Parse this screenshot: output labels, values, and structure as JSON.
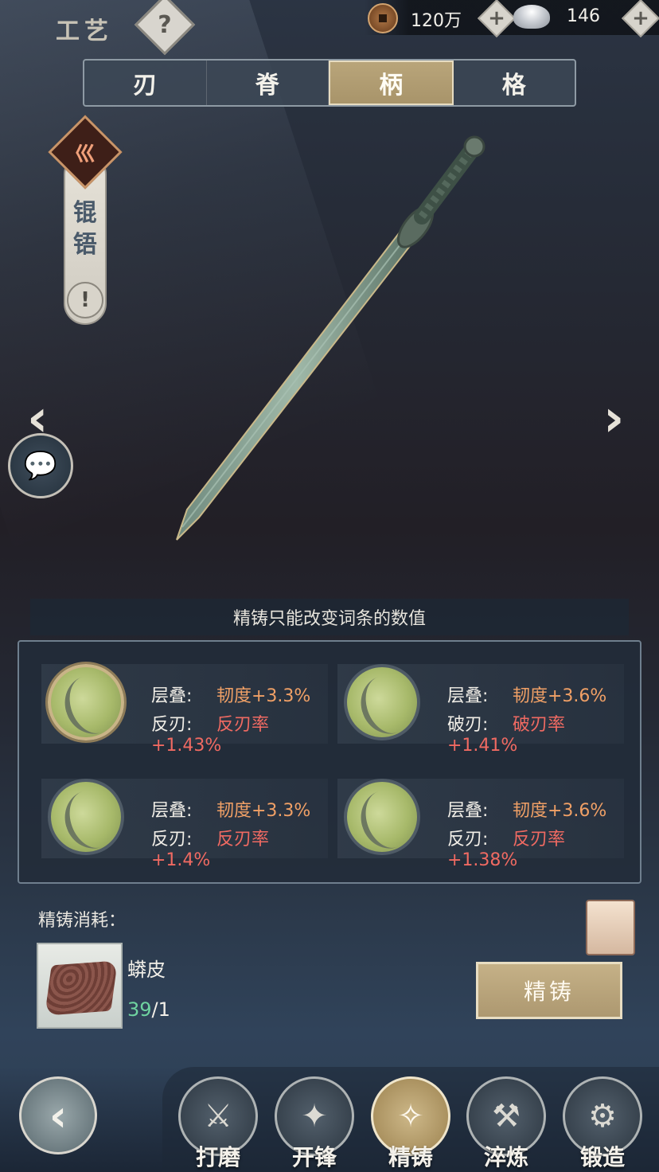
{
  "header": {
    "title": "工艺",
    "help_icon": "question-mark",
    "copper": {
      "icon": "copper-coin-icon",
      "value": "120万"
    },
    "silver": {
      "icon": "silver-ingot-icon",
      "value": "146"
    }
  },
  "tabs": [
    {
      "label": "刃",
      "active": false
    },
    {
      "label": "脊",
      "active": false
    },
    {
      "label": "柄",
      "active": true
    },
    {
      "label": "格",
      "active": false
    }
  ],
  "weapon": {
    "name_line1": "锟",
    "name_line2": "铻",
    "emblem_glyph": "巛",
    "alert_glyph": "!"
  },
  "nav_arrows": {
    "left": "‹",
    "right": "›"
  },
  "info_text": "精铸只能改变词条的数值",
  "attributes": [
    {
      "label1": "层叠:",
      "value1": "韧度+3.3%",
      "label2": "反刃:",
      "value2": "反刃率+1.43%",
      "selected": true
    },
    {
      "label1": "层叠:",
      "value1": "韧度+3.6%",
      "label2": "破刃:",
      "value2": "破刃率+1.41%",
      "selected": false
    },
    {
      "label1": "层叠:",
      "value1": "韧度+3.3%",
      "label2": "反刃:",
      "value2": "反刃率+1.4%",
      "selected": false
    },
    {
      "label1": "层叠:",
      "value1": "韧度+3.6%",
      "label2": "反刃:",
      "value2": "反刃率+1.38%",
      "selected": false
    }
  ],
  "cost": {
    "title": "精铸消耗：",
    "material_name": "蟒皮",
    "have": "39",
    "need": "/1"
  },
  "forge_button": "精铸",
  "bottom_nav": [
    {
      "label": "打磨",
      "icon": "whetstone-icon",
      "glyph": "⚔",
      "active": false
    },
    {
      "label": "开锋",
      "icon": "sharpen-icon",
      "glyph": "✦",
      "active": false
    },
    {
      "label": "精铸",
      "icon": "refine-icon",
      "glyph": "✧",
      "active": true
    },
    {
      "label": "淬炼",
      "icon": "temper-icon",
      "glyph": "⚒",
      "active": false
    },
    {
      "label": "锻造",
      "icon": "anvil-icon",
      "glyph": "⚙",
      "active": false
    }
  ],
  "back_glyph": "‹",
  "colors": {
    "accent_gold": "#b9a57a",
    "value_orange": "#f0a066",
    "value_red": "#f06a62",
    "count_green": "#6fd3a0"
  }
}
